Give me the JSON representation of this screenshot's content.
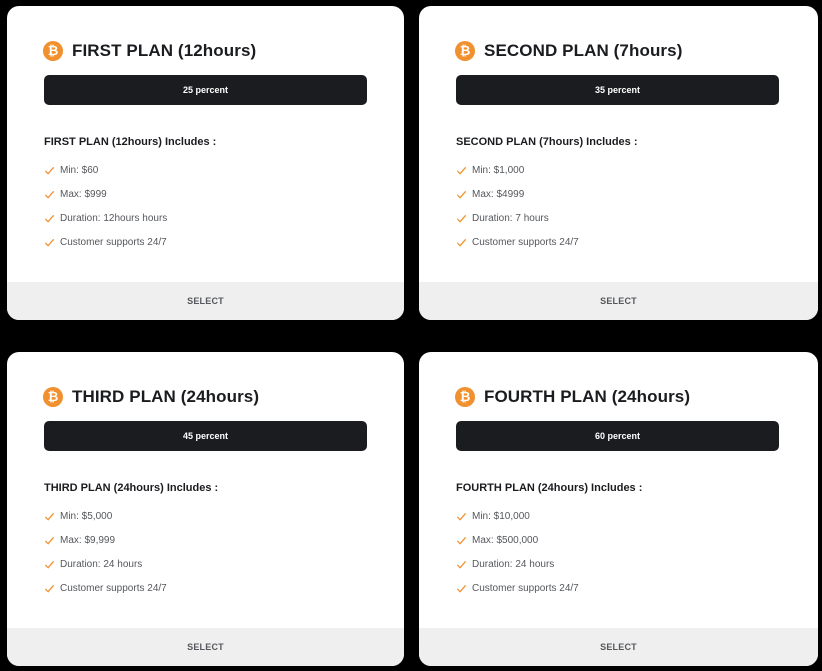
{
  "colors": {
    "accent": "#f1902f",
    "dark": "#1b1c20",
    "card_bg": "#ffffff",
    "select_bg": "#efefef",
    "page_bg": "#000000"
  },
  "icons": {
    "plan_icon": "bitcoin-icon",
    "feature_icon": "check-icon"
  },
  "plans": [
    {
      "title": "FIRST PLAN (12hours)",
      "percent": "25 percent",
      "includes": "FIRST PLAN (12hours) Includes :",
      "features": [
        "Min: $60",
        "Max: $999",
        "Duration: 12hours hours",
        "Customer supports 24/7"
      ],
      "button": "SELECT"
    },
    {
      "title": "SECOND PLAN (7hours)",
      "percent": "35 percent",
      "includes": "SECOND PLAN (7hours) Includes :",
      "features": [
        "Min: $1,000",
        "Max: $4999",
        "Duration: 7 hours",
        "Customer supports 24/7"
      ],
      "button": "SELECT"
    },
    {
      "title": "THIRD PLAN (24hours)",
      "percent": "45 percent",
      "includes": "THIRD PLAN (24hours) Includes :",
      "features": [
        "Min: $5,000",
        "Max: $9,999",
        "Duration: 24 hours",
        "Customer supports 24/7"
      ],
      "button": "SELECT"
    },
    {
      "title": "FOURTH PLAN (24hours)",
      "percent": "60 percent",
      "includes": "FOURTH PLAN (24hours) Includes :",
      "features": [
        "Min: $10,000",
        "Max: $500,000",
        "Duration: 24 hours",
        "Customer supports 24/7"
      ],
      "button": "SELECT"
    }
  ]
}
